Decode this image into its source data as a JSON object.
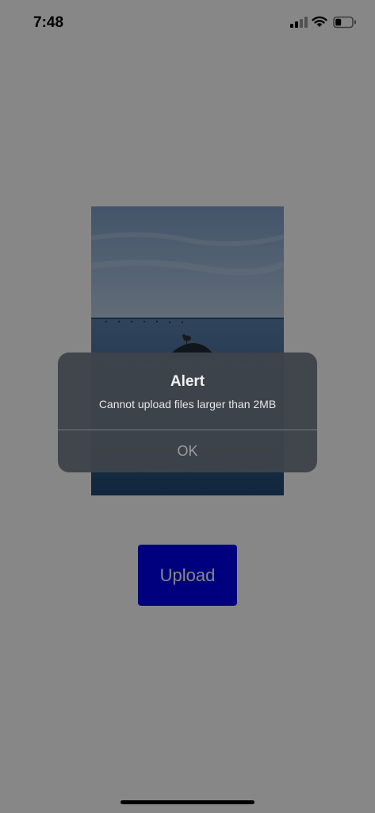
{
  "status_bar": {
    "time": "7:48",
    "icons": [
      "signal-icon",
      "wifi-icon",
      "battery-icon"
    ]
  },
  "photo": {
    "subject": "seascape with seagull on rock"
  },
  "upload_button": {
    "label": "Upload",
    "color": "#0000ee"
  },
  "alert": {
    "title": "Alert",
    "message": "Cannot upload files larger than 2MB",
    "ok_label": "OK"
  }
}
